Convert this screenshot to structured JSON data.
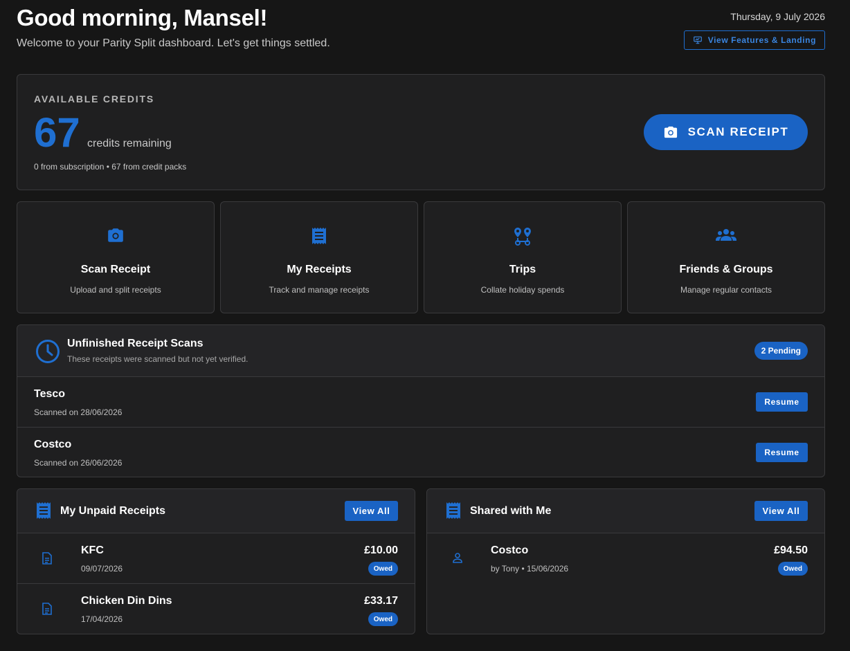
{
  "header": {
    "greeting": "Good morning, Mansel!",
    "subtitle": "Welcome to your Parity Split dashboard. Let's get things settled.",
    "date": "Thursday, 9 July 2026",
    "landing_button": "View Features & Landing"
  },
  "credits": {
    "label": "AVAILABLE CREDITS",
    "count": "67",
    "remaining_text": "credits remaining",
    "breakdown": "0 from subscription • 67 from credit packs",
    "scan_button": "SCAN RECEIPT"
  },
  "actions": [
    {
      "title": "Scan Receipt",
      "desc": "Upload and split receipts",
      "icon": "camera-icon"
    },
    {
      "title": "My Receipts",
      "desc": "Track and manage receipts",
      "icon": "receipt-icon"
    },
    {
      "title": "Trips",
      "desc": "Collate holiday spends",
      "icon": "route-icon"
    },
    {
      "title": "Friends & Groups",
      "desc": "Manage regular contacts",
      "icon": "groups-icon"
    }
  ],
  "unfinished": {
    "title": "Unfinished Receipt Scans",
    "subtitle": "These receipts were scanned but not yet verified.",
    "badge": "2 Pending",
    "resume_label": "Resume",
    "items": [
      {
        "name": "Tesco",
        "date": "Scanned on 28/06/2026"
      },
      {
        "name": "Costco",
        "date": "Scanned on 26/06/2026"
      }
    ]
  },
  "unpaid": {
    "title": "My Unpaid Receipts",
    "view_all": "View All",
    "items": [
      {
        "name": "KFC",
        "meta": "09/07/2026",
        "amount": "£10.00",
        "status": "Owed"
      },
      {
        "name": "Chicken Din Dins",
        "meta": "17/04/2026",
        "amount": "£33.17",
        "status": "Owed"
      }
    ]
  },
  "shared": {
    "title": "Shared with Me",
    "view_all": "View All",
    "items": [
      {
        "name": "Costco",
        "meta": "by Tony • 15/06/2026",
        "amount": "£94.50",
        "status": "Owed"
      }
    ]
  },
  "colors": {
    "accent": "#1a63c4",
    "background": "#161616",
    "card": "#1f1f20"
  }
}
